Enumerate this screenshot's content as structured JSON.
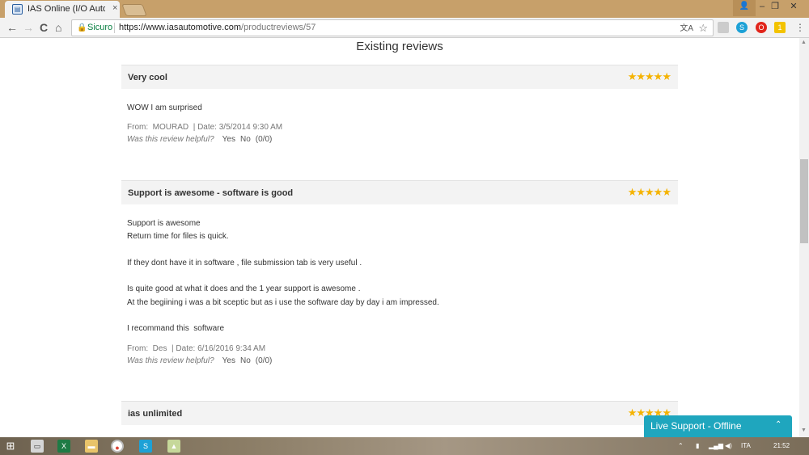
{
  "browser": {
    "tab_title": "IAS Online (I/O Automotive",
    "tab_close": "×",
    "window_controls": {
      "user": "👤",
      "minimize": "–",
      "maximize": "❐",
      "close": "✕"
    },
    "nav": {
      "back": "←",
      "forward": "→",
      "reload": "C",
      "home": "⌂"
    },
    "address": {
      "secure_label": "Sicuro",
      "url_host": "https://www.iasautomotive.com",
      "url_path": "/productreviews/57"
    }
  },
  "page": {
    "heading": "Existing reviews",
    "reviews": [
      {
        "title": "Very cool",
        "rating": 5,
        "stars": "★★★★★",
        "body": [
          "WOW I am surprised"
        ],
        "from_label": "From:",
        "author": "MOURAD",
        "date_text": "| Date: 3/5/2014 9:30 AM",
        "helpful_label": "Was this review helpful?",
        "yes": "Yes",
        "no": "No",
        "votes": "(0/0)"
      },
      {
        "title": "Support is awesome - software is good",
        "rating": 5,
        "stars": "★★★★★",
        "body": [
          "Support is awesome",
          "Return time for files is quick.",
          "",
          "If they dont have it in software , file submission tab is very useful .",
          "",
          "Is quite good at what it does and the 1 year support is awesome .",
          "At the begiining i was a bit sceptic but as i use the software day by day i am impressed.",
          "",
          "I recommand this  software"
        ],
        "from_label": "From:",
        "author": "Des",
        "date_text": "| Date: 6/16/2016 9:34 AM",
        "helpful_label": "Was this review helpful?",
        "yes": "Yes",
        "no": "No",
        "votes": "(0/0)"
      },
      {
        "title": "ias unlimited",
        "rating": 5,
        "stars": "★★★★★"
      }
    ],
    "live_support": {
      "label": "Live Support - Offline",
      "chevron": "⌃"
    }
  },
  "taskbar": {
    "language": "ITA",
    "time": "21:52"
  },
  "colors": {
    "accent": "#1fa6be",
    "star": "#f5b301",
    "chrome": "#c7a06a"
  }
}
